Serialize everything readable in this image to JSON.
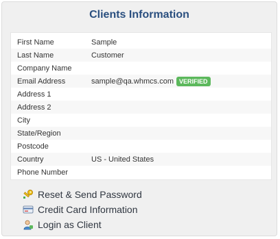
{
  "panel": {
    "title": "Clients Information"
  },
  "fields": [
    {
      "label": "First Name",
      "value": "Sample"
    },
    {
      "label": "Last Name",
      "value": "Customer"
    },
    {
      "label": "Company Name",
      "value": ""
    },
    {
      "label": "Email Address",
      "value": "sample@qa.whmcs.com",
      "badge": "VERIFIED"
    },
    {
      "label": "Address 1",
      "value": ""
    },
    {
      "label": "Address 2",
      "value": ""
    },
    {
      "label": "City",
      "value": ""
    },
    {
      "label": "State/Region",
      "value": ""
    },
    {
      "label": "Postcode",
      "value": ""
    },
    {
      "label": "Country",
      "value": "US - United States"
    },
    {
      "label": "Phone Number",
      "value": ""
    }
  ],
  "actions": [
    {
      "label": "Reset & Send Password",
      "icon": "key-icon"
    },
    {
      "label": "Credit Card Information",
      "icon": "credit-card-icon"
    },
    {
      "label": "Login as Client",
      "icon": "user-icon"
    }
  ],
  "colors": {
    "title": "#2a4f7f",
    "verified_badge": "#5cb85c"
  }
}
